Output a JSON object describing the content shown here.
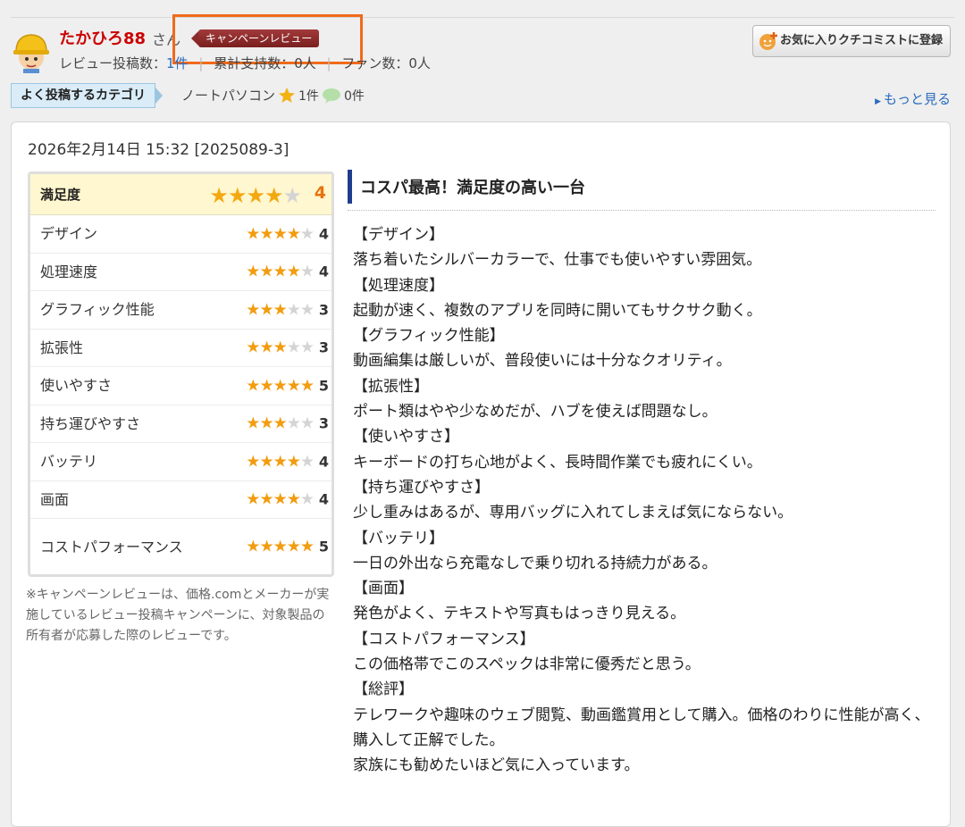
{
  "user": {
    "name": "たかひろ88",
    "honorific": "さん",
    "badge": "キャンペーンレビュー",
    "stats": {
      "review_count_label": "レビュー投稿数：",
      "review_count_value": "1件",
      "support_label": "累計支持数：",
      "support_value": "0人",
      "fans_label": "ファン数：",
      "fans_value": "0人"
    }
  },
  "favorite_button": {
    "label": "お気に入りクチコミストに登録"
  },
  "category": {
    "label": "よく投稿するカテゴリ",
    "name": "ノートパソコン",
    "star_count": "1件",
    "comment_count": "0件",
    "more_link": "もっと見る"
  },
  "review": {
    "datetime": "2026年2月14日 15:32 [2025089-3]",
    "title": "コスパ最高！満足度の高い一台",
    "overall": {
      "label": "満足度",
      "score": 4
    },
    "ratings": [
      {
        "label": "デザイン",
        "score": 4
      },
      {
        "label": "処理速度",
        "score": 4
      },
      {
        "label": "グラフィック性能",
        "score": 3
      },
      {
        "label": "拡張性",
        "score": 3
      },
      {
        "label": "使いやすさ",
        "score": 5
      },
      {
        "label": "持ち運びやすさ",
        "score": 3
      },
      {
        "label": "バッテリ",
        "score": 4
      },
      {
        "label": "画面",
        "score": 4
      },
      {
        "label": "コストパフォーマンス",
        "score": 5
      }
    ],
    "note": "※キャンペーンレビューは、価格.comとメーカーが実施しているレビュー投稿キャンペーンに、対象製品の所有者が応募した際のレビューです。",
    "body_lines": [
      "【デザイン】",
      "落ち着いたシルバーカラーで、仕事でも使いやすい雰囲気。",
      "【処理速度】",
      "起動が速く、複数のアプリを同時に開いてもサクサク動く。",
      "【グラフィック性能】",
      "動画編集は厳しいが、普段使いには十分なクオリティ。",
      "【拡張性】",
      "ポート類はやや少なめだが、ハブを使えば問題なし。",
      "【使いやすさ】",
      "キーボードの打ち心地がよく、長時間作業でも疲れにくい。",
      "【持ち運びやすさ】",
      "少し重みはあるが、専用バッグに入れてしまえば気にならない。",
      "【バッテリ】",
      "一日の外出なら充電なしで乗り切れる持続力がある。",
      "【画面】",
      "発色がよく、テキストや写真もはっきり見える。",
      "【コストパフォーマンス】",
      "この価格帯でこのスペックは非常に優秀だと思う。",
      "【総評】",
      "テレワークや趣味のウェブ閲覧、動画鑑賞用として購入。価格のわりに性能が高く、購入して正解でした。",
      "家族にも勧めたいほど気に入っています。"
    ]
  },
  "colors": {
    "username": "#cc0000",
    "star_on": "#f29c0f",
    "star_off": "#d4d4d4",
    "link": "#2a6bbf",
    "highlight_border": "#f06a1a",
    "title_bar": "#1f3d8f"
  },
  "icons": {
    "avatar": "construction-helmet-avatar",
    "favorite": "add-favorite-icon",
    "star": "star-icon",
    "comment": "speech-bubble-icon"
  }
}
